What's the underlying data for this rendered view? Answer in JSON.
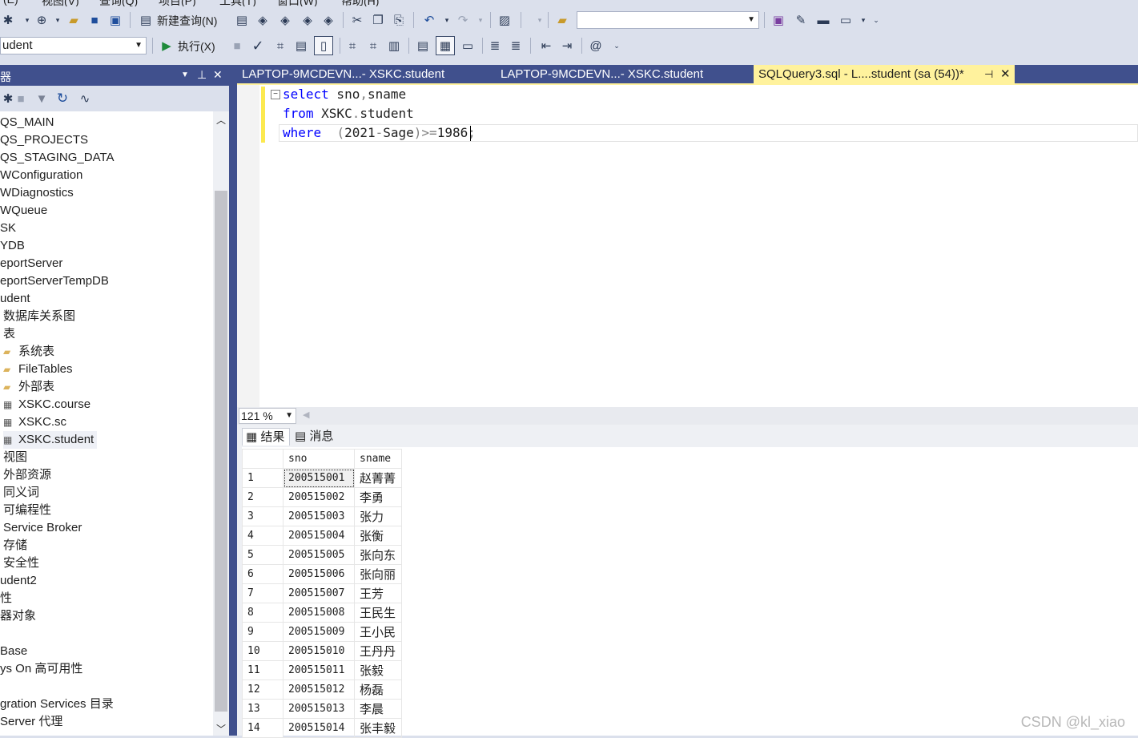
{
  "menubar": {
    "items": [
      "(E)",
      "视图(V)",
      "查询(Q)",
      "项目(P)",
      "工具(T)",
      "窗口(W)",
      "帮助(H)"
    ]
  },
  "toolbar1": {
    "new_query_label": "新建查询(N)",
    "buttons": [
      "new-project-icon",
      "add-item-icon",
      "open-folder-icon",
      "save-icon",
      "save-all-icon",
      "new-query-icon",
      "mdx-query-icon",
      "dmx-query-icon",
      "xmla-query-icon",
      "dax-query-icon",
      "cut-icon",
      "copy-icon",
      "paste-icon",
      "undo-icon",
      "redo-icon",
      "activity-monitor-icon",
      "find-in-files-icon",
      "solution-explorer-icon",
      "properties-icon",
      "toolbox-icon",
      "command-window-icon"
    ],
    "search_value": ""
  },
  "toolbar2": {
    "database_value": "udent",
    "execute_label": "执行(X)"
  },
  "object_explorer": {
    "title": "器",
    "items": [
      {
        "label": "QS_MAIN",
        "indent": 0,
        "icon": ""
      },
      {
        "label": "QS_PROJECTS",
        "indent": 0,
        "icon": ""
      },
      {
        "label": "QS_STAGING_DATA",
        "indent": 0,
        "icon": ""
      },
      {
        "label": "WConfiguration",
        "indent": 0,
        "icon": ""
      },
      {
        "label": "WDiagnostics",
        "indent": 0,
        "icon": ""
      },
      {
        "label": "WQueue",
        "indent": 0,
        "icon": ""
      },
      {
        "label": "SK",
        "indent": 0,
        "icon": ""
      },
      {
        "label": "YDB",
        "indent": 0,
        "icon": ""
      },
      {
        "label": "eportServer",
        "indent": 0,
        "icon": ""
      },
      {
        "label": "eportServerTempDB",
        "indent": 0,
        "icon": ""
      },
      {
        "label": "udent",
        "indent": 0,
        "icon": ""
      },
      {
        "label": "数据库关系图",
        "indent": 1,
        "icon": ""
      },
      {
        "label": "表",
        "indent": 1,
        "icon": ""
      },
      {
        "label": "系统表",
        "indent": 2,
        "icon": "folder"
      },
      {
        "label": "FileTables",
        "indent": 2,
        "icon": "folder"
      },
      {
        "label": "外部表",
        "indent": 2,
        "icon": "folder"
      },
      {
        "label": "XSKC.course",
        "indent": 2,
        "icon": "table"
      },
      {
        "label": "XSKC.sc",
        "indent": 2,
        "icon": "table"
      },
      {
        "label": "XSKC.student",
        "indent": 2,
        "icon": "table",
        "selected": true
      },
      {
        "label": "视图",
        "indent": 1,
        "icon": ""
      },
      {
        "label": "外部资源",
        "indent": 1,
        "icon": ""
      },
      {
        "label": "同义词",
        "indent": 1,
        "icon": ""
      },
      {
        "label": "可编程性",
        "indent": 1,
        "icon": ""
      },
      {
        "label": "Service Broker",
        "indent": 1,
        "icon": ""
      },
      {
        "label": "存储",
        "indent": 1,
        "icon": ""
      },
      {
        "label": "安全性",
        "indent": 1,
        "icon": ""
      },
      {
        "label": "udent2",
        "indent": 0,
        "icon": ""
      },
      {
        "label": "性",
        "indent": 0,
        "icon": ""
      },
      {
        "label": "器对象",
        "indent": 0,
        "icon": ""
      },
      {
        "label": "",
        "indent": 0,
        "icon": ""
      },
      {
        "label": "Base",
        "indent": 0,
        "icon": ""
      },
      {
        "label": "ys On 高可用性",
        "indent": 0,
        "icon": ""
      },
      {
        "label": "",
        "indent": 0,
        "icon": ""
      },
      {
        "label": "gration Services 目录",
        "indent": 0,
        "icon": ""
      },
      {
        "label": "Server 代理",
        "indent": 0,
        "icon": ""
      }
    ]
  },
  "tabs": [
    {
      "label": "LAPTOP-9MCDEVN...- XSKC.student",
      "active": false
    },
    {
      "label": "LAPTOP-9MCDEVN...- XSKC.student",
      "active": false
    },
    {
      "label": "SQLQuery3.sql - L....student (sa (54))*",
      "active": true
    }
  ],
  "editor": {
    "line1": {
      "kw": "select",
      "rest": " sno",
      "op": ",",
      "rest2": "sname"
    },
    "line2": {
      "kw": "from",
      "rest": " XSKC",
      "op": ".",
      "rest2": "student"
    },
    "line3": {
      "kw": "where",
      "pre": "  ",
      "op1": "(",
      "num1": "2021",
      "op2": "-",
      "ident": "Sage",
      "op3": ")>=",
      "num2": "1986",
      "op4": ";"
    }
  },
  "zoom": {
    "value": "121 %"
  },
  "results_tabs": [
    {
      "label": "结果",
      "active": true
    },
    {
      "label": "消息",
      "active": false
    }
  ],
  "grid": {
    "columns": [
      "sno",
      "sname"
    ],
    "rows": [
      [
        "1",
        "200515001",
        "赵菁菁"
      ],
      [
        "2",
        "200515002",
        "李勇"
      ],
      [
        "3",
        "200515003",
        "张力"
      ],
      [
        "4",
        "200515004",
        "张衡"
      ],
      [
        "5",
        "200515005",
        "张向东"
      ],
      [
        "6",
        "200515006",
        "张向丽"
      ],
      [
        "7",
        "200515007",
        "王芳"
      ],
      [
        "8",
        "200515008",
        "王民生"
      ],
      [
        "9",
        "200515009",
        "王小民"
      ],
      [
        "10",
        "200515010",
        "王丹丹"
      ],
      [
        "11",
        "200515011",
        "张毅"
      ],
      [
        "12",
        "200515012",
        "杨磊"
      ],
      [
        "13",
        "200515013",
        "李晨"
      ],
      [
        "14",
        "200515014",
        "张丰毅"
      ]
    ]
  },
  "watermark": "CSDN @kl_xiao",
  "colors": {
    "accent": "#40508d",
    "active_tab": "#fff29d",
    "keyword": "#0000ff",
    "operator": "#808080"
  }
}
